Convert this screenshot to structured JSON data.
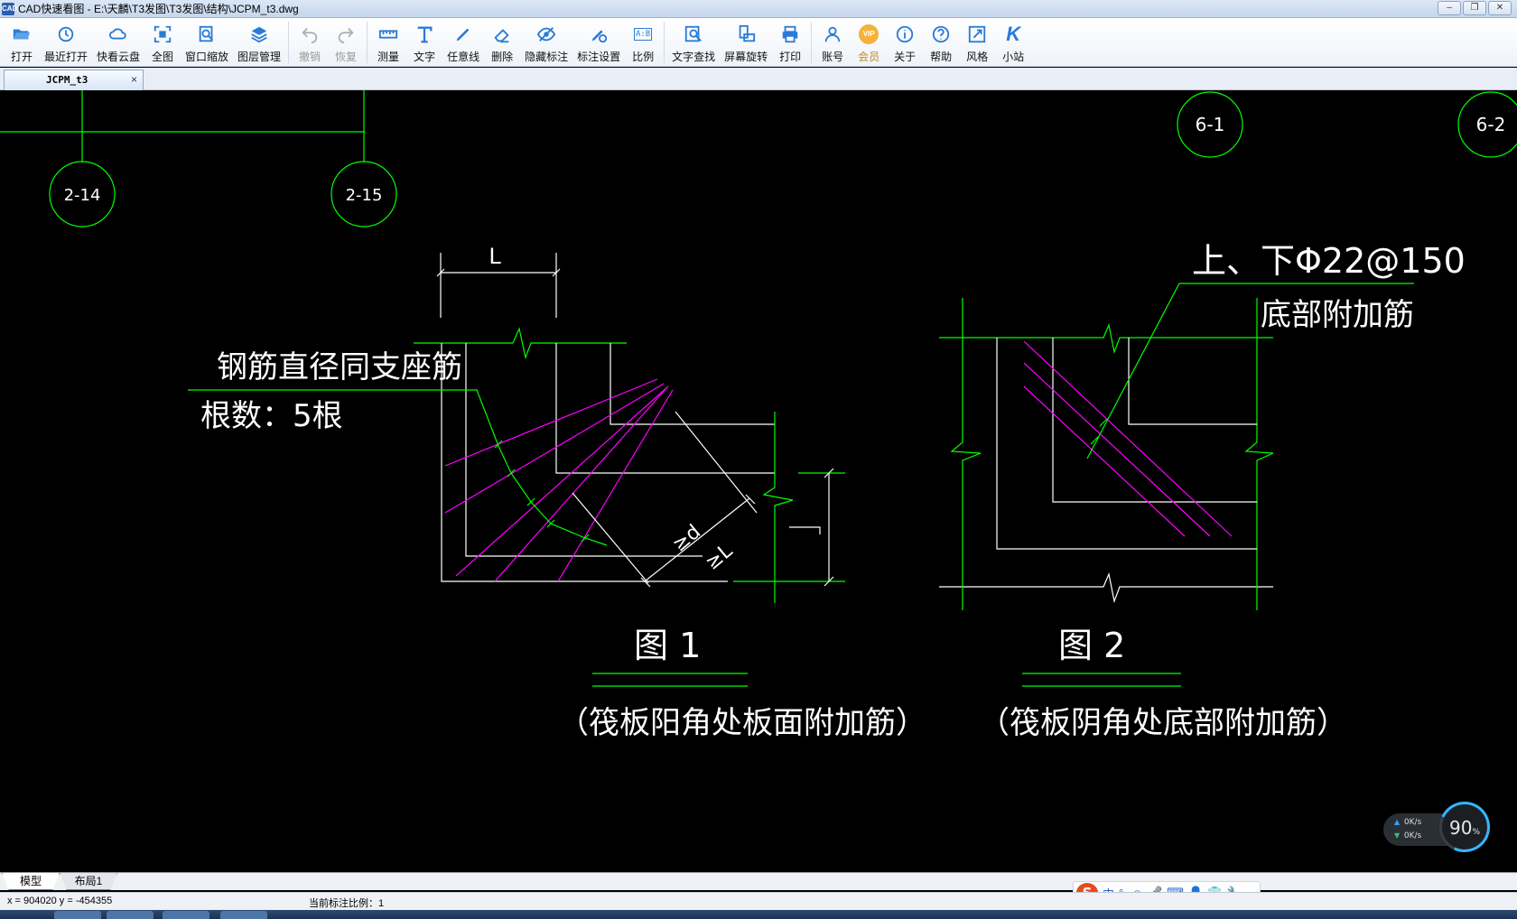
{
  "window": {
    "title": "CAD快速看图 - E:\\天麟\\T3发图\\T3发图\\结构\\JCPM_t3.dwg",
    "app_icon_label": "CAD",
    "minimize_label": "–",
    "restore_label": "❐",
    "close_label": "✕"
  },
  "toolbar": {
    "items": [
      {
        "id": "open",
        "label": "打开",
        "icon": "folder-open-icon",
        "enabled": true
      },
      {
        "id": "recent",
        "label": "最近打开",
        "icon": "history-icon",
        "enabled": true
      },
      {
        "id": "cloud",
        "label": "快看云盘",
        "icon": "cloud-icon",
        "enabled": true
      },
      {
        "id": "fullview",
        "label": "全图",
        "icon": "fit-view-icon",
        "enabled": true
      },
      {
        "id": "window-zoom",
        "label": "窗口缩放",
        "icon": "window-zoom-icon",
        "enabled": true
      },
      {
        "id": "layers",
        "label": "图层管理",
        "icon": "layers-icon",
        "enabled": true
      },
      {
        "id": "undo",
        "label": "撤销",
        "icon": "undo-icon",
        "enabled": false
      },
      {
        "id": "redo",
        "label": "恢复",
        "icon": "redo-icon",
        "enabled": false
      },
      {
        "id": "measure",
        "label": "测量",
        "icon": "ruler-icon",
        "enabled": true
      },
      {
        "id": "text",
        "label": "文字",
        "icon": "text-icon",
        "enabled": true
      },
      {
        "id": "freeline",
        "label": "任意线",
        "icon": "pen-icon",
        "enabled": true
      },
      {
        "id": "delete",
        "label": "删除",
        "icon": "eraser-icon",
        "enabled": true
      },
      {
        "id": "hide-annot",
        "label": "隐藏标注",
        "icon": "eye-hidden-icon",
        "enabled": true
      },
      {
        "id": "annot-settings",
        "label": "标注设置",
        "icon": "annotation-settings-icon",
        "enabled": true
      },
      {
        "id": "scale",
        "label": "比例",
        "icon": "scale-icon",
        "enabled": true
      },
      {
        "id": "text-search",
        "label": "文字查找",
        "icon": "text-search-icon",
        "enabled": true
      },
      {
        "id": "rotate",
        "label": "屏幕旋转",
        "icon": "rotate-screen-icon",
        "enabled": true
      },
      {
        "id": "print",
        "label": "打印",
        "icon": "printer-icon",
        "enabled": true
      },
      {
        "id": "account",
        "label": "账号",
        "icon": "user-icon",
        "enabled": true
      },
      {
        "id": "vip",
        "label": "会员",
        "icon": "vip-icon",
        "enabled": true
      },
      {
        "id": "about",
        "label": "关于",
        "icon": "info-icon",
        "enabled": true
      },
      {
        "id": "help",
        "label": "帮助",
        "icon": "help-icon",
        "enabled": true
      },
      {
        "id": "style",
        "label": "风格",
        "icon": "style-icon",
        "enabled": true
      },
      {
        "id": "site",
        "label": "小站",
        "icon": "site-k-icon",
        "enabled": true
      }
    ],
    "icon_text": {
      "scale": "A:B",
      "vip": "VIP",
      "site": "K"
    }
  },
  "doc_tab": {
    "label": "JCPM_t3",
    "close_label": "×"
  },
  "drawing": {
    "axis_bubbles": [
      "2-14",
      "2-15",
      "6-1",
      "6-2"
    ],
    "fig1": {
      "dim_label": "L",
      "note_line1": "钢筋直径同支座筋",
      "note_line2": "根数：5根",
      "dim_diag_1": "≥d",
      "dim_diag_2": "≥L",
      "dim_right": "L",
      "caption": "图 1",
      "subcaption": "（筏板阳角处板面附加筋）"
    },
    "fig2": {
      "note_line1": "上、下Φ22@150",
      "note_line2": "底部附加筋",
      "caption": "图 2",
      "subcaption": "（筏板阴角处底部附加筋）"
    },
    "colors": {
      "white": "#ffffff",
      "green": "#00ff00",
      "magenta": "#ff00ff",
      "background": "#000000"
    }
  },
  "speed_widget": {
    "up": "0K/s",
    "down": "0K/s",
    "percent": "90",
    "percent_unit": "%"
  },
  "layout_tabs": [
    "模型",
    "布局1"
  ],
  "ime": {
    "logo": "S",
    "items": [
      "中",
      "°,",
      "☺",
      "🎤",
      "⌨",
      "👤",
      "👕",
      "🔧"
    ]
  },
  "status": {
    "coords": "x = 904020  y = -454355",
    "scale": "当前标注比例：1"
  }
}
